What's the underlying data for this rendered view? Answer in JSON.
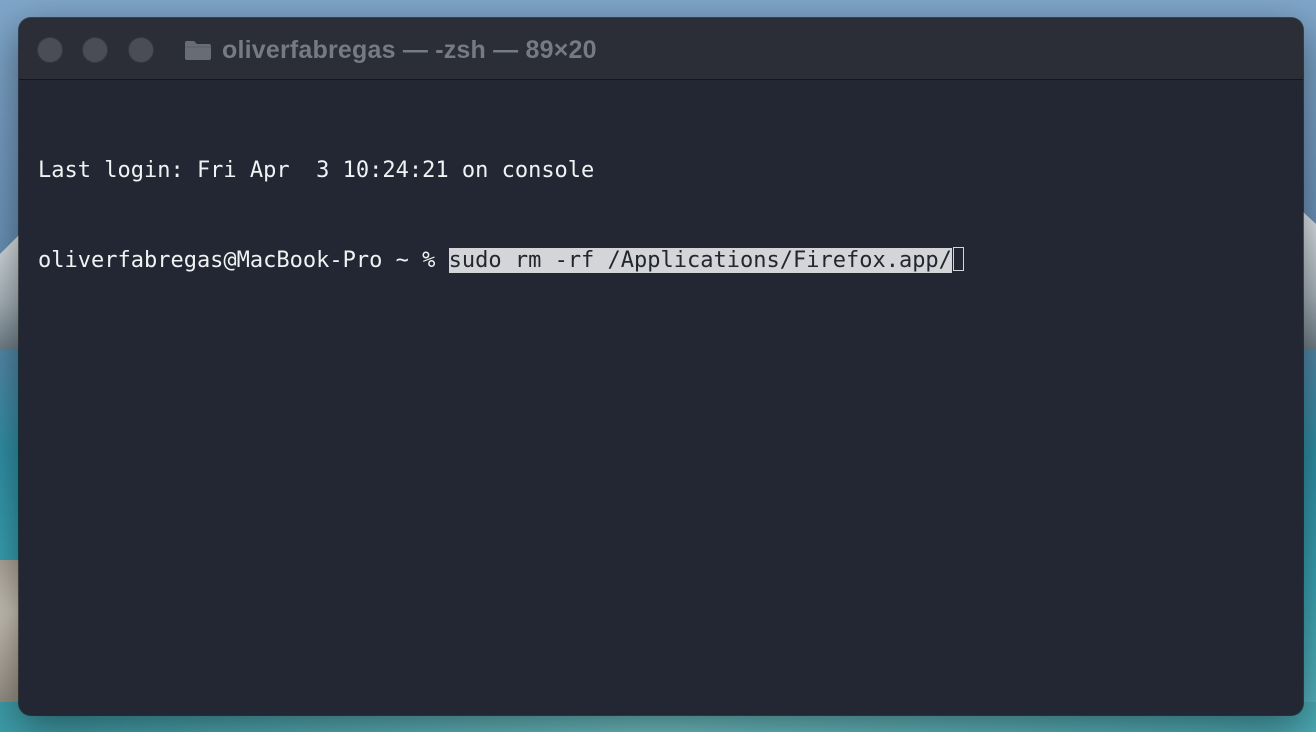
{
  "window": {
    "title": "oliverfabregas — -zsh — 89×20",
    "controls": {
      "close_color": "#4a4d55",
      "minimize_color": "#4a4d55",
      "zoom_color": "#4a4d55"
    },
    "title_icon": "folder-icon"
  },
  "terminal": {
    "last_login": "Last login: Fri Apr  3 10:24:21 on console",
    "prompt": "oliverfabregas@MacBook-Pro ~ % ",
    "command": "sudo rm -rf /Applications/Firefox.app/",
    "background_color": "#232733",
    "text_color": "#f1f2f4",
    "selection_color": "#d4d5d8"
  }
}
